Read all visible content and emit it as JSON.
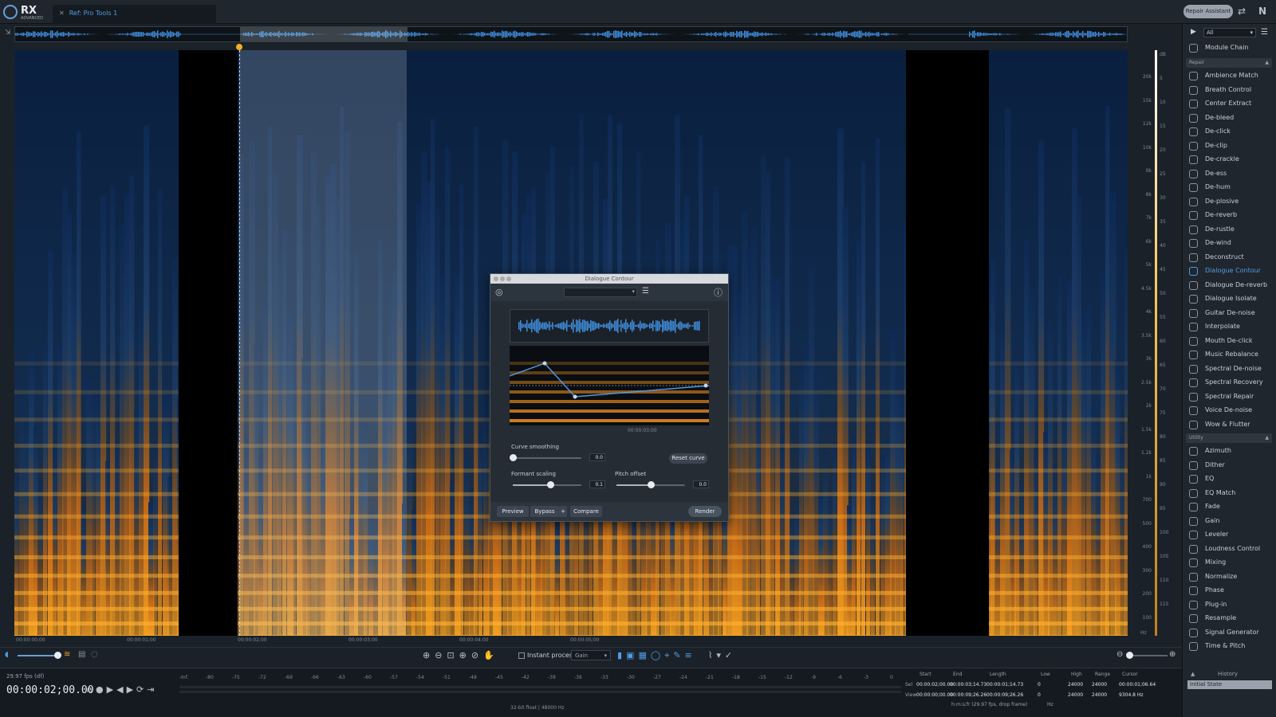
{
  "app": {
    "logo_text": "RX",
    "logo_sub": "ADVANCED",
    "tab_label": "Ref: Pro Tools 1",
    "repair_assistant": "Repair Assistant"
  },
  "timeline": {
    "labels": [
      "00:00:00;00",
      "00:00:01;00",
      "00:00:02;00",
      "00:00:03;00",
      "00:00:04;00",
      "00:00:05;00"
    ]
  },
  "freq_labels": [
    "20k",
    "15k",
    "12k",
    "10k",
    "9k",
    "8k",
    "7k",
    "6k",
    "5k",
    "4.5k",
    "4k",
    "3.5k",
    "3k",
    "2.5k",
    "2k",
    "1.5k",
    "1.2k",
    "1k",
    "700",
    "500",
    "400",
    "300",
    "200",
    "100"
  ],
  "db_labels": [
    "dB",
    "5",
    "10",
    "15",
    "20",
    "25",
    "30",
    "35",
    "40",
    "45",
    "50",
    "55",
    "60",
    "65",
    "70",
    "75",
    "80",
    "85",
    "90",
    "95",
    "100",
    "105",
    "110",
    "115"
  ],
  "freq_unit": "Hz",
  "toolbar": {
    "instant_process": "Instant process",
    "gain_select": "Gain"
  },
  "transport": {
    "fps": "29.97 fps (df)",
    "timecode": "00:00:02;00.00"
  },
  "meter": {
    "labels": [
      "-Inf.",
      "-80",
      "-75",
      "-72",
      "-69",
      "-66",
      "-63",
      "-60",
      "-57",
      "-54",
      "-51",
      "-48",
      "-45",
      "-42",
      "-39",
      "-36",
      "-33",
      "-30",
      "-27",
      "-24",
      "-21",
      "-18",
      "-15",
      "-12",
      "-9",
      "-6",
      "-3",
      "0"
    ],
    "format": "32-bit float | 48000 Hz"
  },
  "selection": {
    "headers": [
      "Start",
      "End",
      "Length",
      "Low",
      "High",
      "Range",
      "Cursor"
    ],
    "sel_label": "Sel",
    "view_label": "View",
    "sel": [
      "00:00:02;00.00",
      "00:00:03;14.73",
      "00:00:01;14.73",
      "0",
      "24000",
      "24000",
      "00:00:01;06.64"
    ],
    "view": [
      "00:00:00;00.00",
      "00:00:09;26.26",
      "00:00:09;26.26",
      "0",
      "24000",
      "24000",
      "9304.8 Hz"
    ],
    "format_note": "h:m:s;fr (29.97 fps, drop frame)",
    "unit": "Hz"
  },
  "right_panel": {
    "filter": "All",
    "module_chain": "Module Chain",
    "repair_label": "Repair",
    "repair_items": [
      "Ambience Match",
      "Breath Control",
      "Center Extract",
      "De-bleed",
      "De-click",
      "De-clip",
      "De-crackle",
      "De-ess",
      "De-hum",
      "De-plosive",
      "De-reverb",
      "De-rustle",
      "De-wind",
      "Deconstruct",
      "Dialogue Contour",
      "Dialogue De-reverb",
      "Dialogue Isolate",
      "Guitar De-noise",
      "Interpolate",
      "Mouth De-click",
      "Music Rebalance",
      "Spectral De-noise",
      "Spectral Recovery",
      "Spectral Repair",
      "Voice De-noise",
      "Wow & Flutter"
    ],
    "utility_label": "Utility",
    "utility_items": [
      "Azimuth",
      "Dither",
      "EQ",
      "EQ Match",
      "Fade",
      "Gain",
      "Leveler",
      "Loudness Control",
      "Mixing",
      "Normalize",
      "Phase",
      "Plug-in",
      "Resample",
      "Signal Generator",
      "Time & Pitch"
    ],
    "selected": "Dialogue Contour"
  },
  "history": {
    "title": "History",
    "item": "Initial State"
  },
  "dialog": {
    "title": "Dialogue Contour",
    "timecode": "00:00:03;00",
    "curve_smoothing": {
      "label": "Curve smoothing",
      "value": "0.0",
      "level": 0.0
    },
    "reset": "Reset curve",
    "formant": {
      "label": "Formant scaling",
      "value": "0.1",
      "level": 0.55
    },
    "pitch": {
      "label": "Pitch offset",
      "value": "0.0",
      "level": 0.5
    },
    "preview": "Preview",
    "bypass": "Bypass",
    "plus": "+",
    "compare": "Compare",
    "render": "Render"
  }
}
